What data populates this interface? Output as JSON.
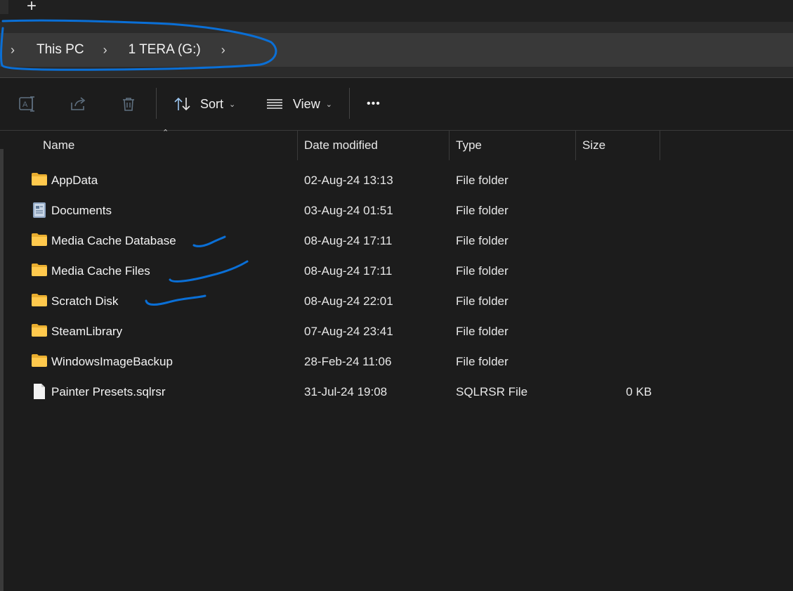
{
  "tabs": {
    "new_tab_glyph": "+"
  },
  "breadcrumb": {
    "items": [
      {
        "label": "This PC"
      },
      {
        "label": "1 TERA (G:)"
      }
    ]
  },
  "toolbar": {
    "rename_icon": "rename-icon",
    "share_icon": "share-icon",
    "delete_icon": "trash-icon",
    "sort_label": "Sort",
    "view_label": "View",
    "more_label": "•••"
  },
  "columns": {
    "name": "Name",
    "date": "Date modified",
    "type": "Type",
    "size": "Size"
  },
  "files": [
    {
      "name": "AppData",
      "date": "02-Aug-24 13:13",
      "type": "File folder",
      "size": "",
      "icon": "folder-icon"
    },
    {
      "name": "Documents",
      "date": "03-Aug-24 01:51",
      "type": "File folder",
      "size": "",
      "icon": "documents-icon"
    },
    {
      "name": "Media Cache Database",
      "date": "08-Aug-24 17:11",
      "type": "File folder",
      "size": "",
      "icon": "folder-icon"
    },
    {
      "name": "Media Cache Files",
      "date": "08-Aug-24 17:11",
      "type": "File folder",
      "size": "",
      "icon": "folder-icon"
    },
    {
      "name": "Scratch Disk",
      "date": "08-Aug-24 22:01",
      "type": "File folder",
      "size": "",
      "icon": "folder-icon"
    },
    {
      "name": "SteamLibrary",
      "date": "07-Aug-24 23:41",
      "type": "File folder",
      "size": "",
      "icon": "folder-icon"
    },
    {
      "name": "WindowsImageBackup",
      "date": "28-Feb-24 11:06",
      "type": "File folder",
      "size": "",
      "icon": "folder-icon"
    },
    {
      "name": "Painter Presets.sqlrsr",
      "date": "31-Jul-24 19:08",
      "type": "SQLRSR File",
      "size": "0 KB",
      "icon": "file-icon"
    }
  ],
  "colors": {
    "background": "#1c1c1c",
    "address_bar": "#393939",
    "folder": "#f2c04a",
    "annotation_ink": "#0a6fd6"
  }
}
